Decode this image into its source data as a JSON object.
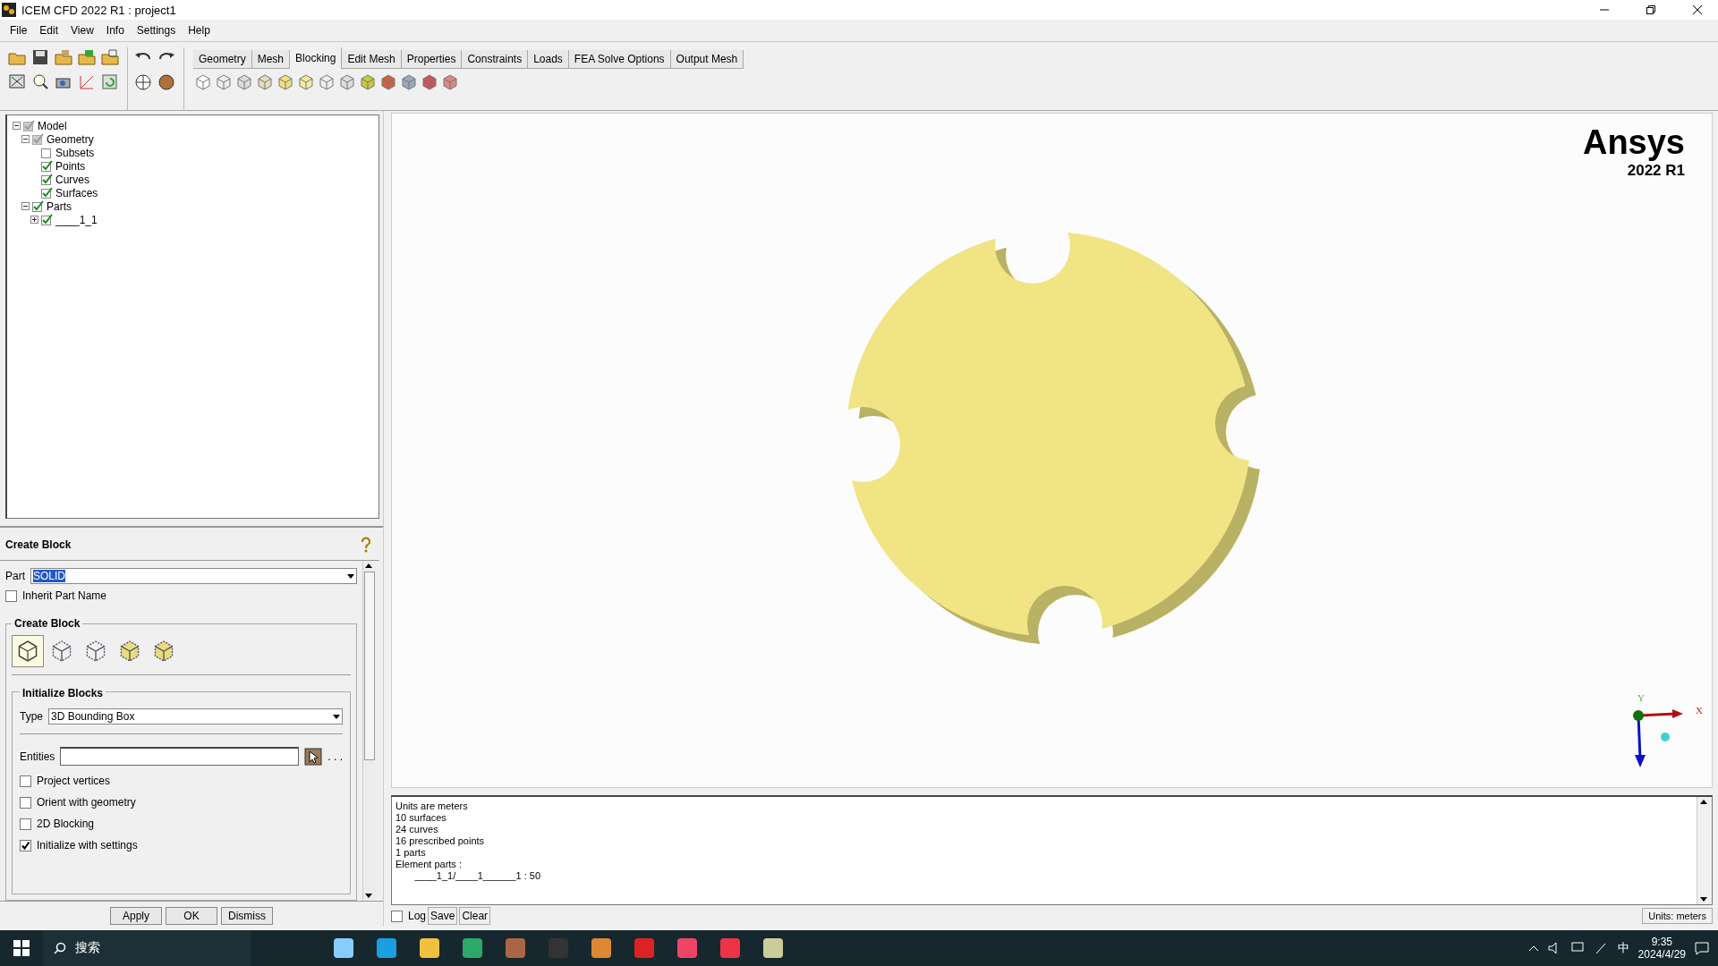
{
  "window": {
    "title": "ICEM CFD 2022 R1 : project1"
  },
  "menu": [
    "File",
    "Edit",
    "View",
    "Info",
    "Settings",
    "Help"
  ],
  "tabs": [
    {
      "label": "Geometry",
      "selected": false
    },
    {
      "label": "Mesh",
      "selected": false
    },
    {
      "label": "Blocking",
      "selected": true
    },
    {
      "label": "Edit Mesh",
      "selected": false
    },
    {
      "label": "Properties",
      "selected": false
    },
    {
      "label": "Constraints",
      "selected": false
    },
    {
      "label": "Loads",
      "selected": false
    },
    {
      "label": "FEA Solve Options",
      "selected": false
    },
    {
      "label": "Output Mesh",
      "selected": false
    }
  ],
  "tree": [
    {
      "label": "Model",
      "checked": true,
      "partial": true,
      "expanded": true,
      "children": [
        {
          "label": "Geometry",
          "checked": true,
          "partial": true,
          "expanded": true,
          "children": [
            {
              "label": "Subsets",
              "checked": false,
              "partial": false
            },
            {
              "label": "Points",
              "checked": true,
              "partial": false
            },
            {
              "label": "Curves",
              "checked": true,
              "partial": false
            },
            {
              "label": "Surfaces",
              "checked": true,
              "partial": false
            }
          ]
        },
        {
          "label": "Parts",
          "checked": true,
          "partial": false,
          "expanded": true,
          "children": [
            {
              "label": "____1_1",
              "checked": true,
              "partial": false,
              "expanded": false
            }
          ]
        }
      ]
    }
  ],
  "panel": {
    "title": "Create Block",
    "part_label": "Part",
    "part_value": "SOLID",
    "inherit": {
      "label": "Inherit Part Name",
      "checked": false
    },
    "create_section": "Create Block",
    "block_types": [
      {
        "selected": true
      },
      {
        "selected": false
      },
      {
        "selected": false
      },
      {
        "selected": false
      },
      {
        "selected": false
      }
    ],
    "init_section": "Initialize Blocks",
    "type_label": "Type",
    "type_value": "3D Bounding Box",
    "entities_label": "Entities",
    "more": ". . .",
    "options": [
      {
        "label": "Project vertices",
        "checked": false
      },
      {
        "label": "Orient with geometry",
        "checked": false
      },
      {
        "label": "2D Blocking",
        "checked": false
      },
      {
        "label": "Initialize with settings",
        "checked": true
      }
    ],
    "buttons": [
      "Apply",
      "OK",
      "Dismiss"
    ]
  },
  "viewport": {
    "logo": "Ansys",
    "version": "2022 R1",
    "axis_x": "X",
    "axis_y": "Y"
  },
  "log": {
    "lines": [
      "Units are meters",
      "10 surfaces",
      "24 curves",
      "16 prescribed points",
      "1 parts",
      "Element parts :",
      "       ____1_1/____1______1 : 50"
    ],
    "log_toggle": {
      "label": "Log",
      "checked": false
    },
    "buttons": [
      "Save",
      "Clear"
    ],
    "units": "Units: meters"
  },
  "taskbar": {
    "search": "搜索",
    "ime": "中",
    "time": "9:35",
    "date": "2024/4/29"
  }
}
